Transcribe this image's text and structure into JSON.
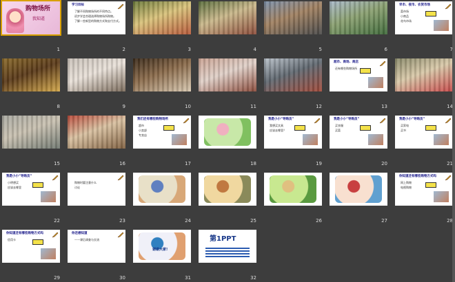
{
  "slides": [
    {
      "n": "1",
      "kind": "title",
      "title": "购物场所",
      "subtitle": "我知道"
    },
    {
      "n": "2",
      "kind": "text",
      "heading": "学习目标",
      "lines": [
        "了解不同购物场所的不同特点。",
        "初步学会合理选择购物场所购物。",
        "了解一些新型的购物方式和支付方式。"
      ]
    },
    {
      "n": "3",
      "kind": "photo",
      "colors": [
        "#6b7a3a",
        "#b85a3a",
        "#d9c27a"
      ]
    },
    {
      "n": "4",
      "kind": "photo",
      "colors": [
        "#5a6d3c",
        "#8c4c3a",
        "#c9b78a"
      ]
    },
    {
      "n": "5",
      "kind": "photo",
      "colors": [
        "#7a8fa8",
        "#4a4a4a",
        "#a08060"
      ]
    },
    {
      "n": "6",
      "kind": "photo",
      "colors": [
        "#a8b8c8",
        "#3f6a3a",
        "#8aa070"
      ]
    },
    {
      "n": "7",
      "kind": "textpic",
      "heading": "早市、夜市、农贸市场",
      "lines": [
        "菜市场",
        "小商品",
        "花鸟市场"
      ]
    },
    {
      "n": "8",
      "kind": "photo",
      "colors": [
        "#8a6a2a",
        "#d4a84a",
        "#5a3a1a"
      ]
    },
    {
      "n": "9",
      "kind": "photo",
      "colors": [
        "#c8c0b8",
        "#7a6a5a",
        "#e8e0d8"
      ]
    },
    {
      "n": "10",
      "kind": "photo",
      "colors": [
        "#3a2a1a",
        "#d8c8b0",
        "#8a6a4a"
      ]
    },
    {
      "n": "11",
      "kind": "photo",
      "colors": [
        "#c8a090",
        "#8a4a3a",
        "#e0d0c8"
      ]
    },
    {
      "n": "12",
      "kind": "photo",
      "colors": [
        "#b8c0c8",
        "#a04a3a",
        "#606870"
      ]
    },
    {
      "n": "13",
      "kind": "textpic",
      "heading": "超市、商场、商店",
      "lines": [
        "还有哪些购物场所"
      ]
    },
    {
      "n": "14",
      "kind": "photo",
      "colors": [
        "#8a8a6a",
        "#c84a4a",
        "#d8c8a8"
      ]
    },
    {
      "n": "15",
      "kind": "photo",
      "colors": [
        "#a8a8a0",
        "#707870",
        "#c8c0b0"
      ]
    },
    {
      "n": "16",
      "kind": "photo",
      "colors": [
        "#b84a3a",
        "#806040",
        "#d8c0a0"
      ]
    },
    {
      "n": "17",
      "kind": "textpic",
      "heading": "我们还有哪些购物场所",
      "lines": [
        "超市",
        "小卖部",
        "专卖店"
      ]
    },
    {
      "n": "18",
      "kind": "cartoon",
      "colors": [
        "#c8e8a8",
        "#f0b0c0",
        "#80c060"
      ]
    },
    {
      "n": "19",
      "kind": "textpic",
      "heading": "我是小小“导购员”",
      "lines": [
        "我想买文具",
        "应该去哪里？"
      ]
    },
    {
      "n": "20",
      "kind": "textpic",
      "heading": "我是小小“导购员”",
      "lines": [
        "买衣服",
        "买菜"
      ]
    },
    {
      "n": "21",
      "kind": "textpic",
      "heading": "我是小小“导购员”",
      "lines": [
        "买家电",
        "买书"
      ]
    },
    {
      "n": "22",
      "kind": "textpic",
      "heading": "我是小小“导购员”",
      "lines": [
        "小明想买",
        "应该去哪里"
      ]
    },
    {
      "n": "23",
      "kind": "text",
      "heading": "",
      "lines": [
        "购物时要注意什么",
        "讨论"
      ]
    },
    {
      "n": "24",
      "kind": "cartoon",
      "colors": [
        "#e8e0c8",
        "#6080c0",
        "#d8a878"
      ]
    },
    {
      "n": "25",
      "kind": "cartoon",
      "colors": [
        "#f0d8a0",
        "#c07840",
        "#8a8a5a"
      ]
    },
    {
      "n": "26",
      "kind": "cartoon",
      "colors": [
        "#c8e890",
        "#e0c080",
        "#5a9a40"
      ]
    },
    {
      "n": "27",
      "kind": "cartoon",
      "colors": [
        "#f8e0d0",
        "#c84040",
        "#60a0d0"
      ]
    },
    {
      "n": "28",
      "kind": "textpic",
      "heading": "你知道还有哪些购物方式吗",
      "lines": [
        "网上购物",
        "电视购物"
      ]
    },
    {
      "n": "29",
      "kind": "textpic",
      "heading": "你知道还有哪些购物方式吗",
      "lines": [
        "信用卡"
      ]
    },
    {
      "n": "30",
      "kind": "text",
      "heading": "你还想知道",
      "lines": [
        "——课后调查与交流"
      ]
    },
    {
      "n": "31",
      "kind": "cartoon",
      "colors": [
        "#f0f0f8",
        "#3080c0",
        "#e0a070"
      ],
      "caption": "谢谢大家!"
    },
    {
      "n": "32",
      "kind": "brand",
      "logo": "第1PPT"
    }
  ]
}
